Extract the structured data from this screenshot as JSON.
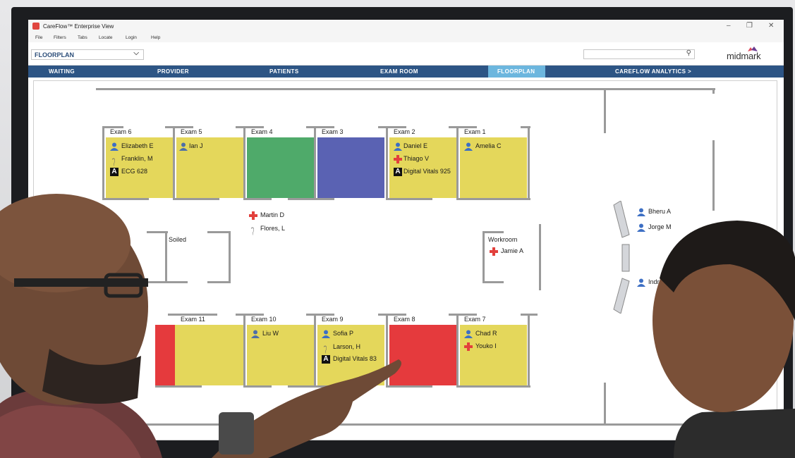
{
  "window": {
    "title": "CareFlow™ Enterprise View"
  },
  "menu": [
    "File",
    "Filters",
    "Tabs",
    "Locate",
    "Login",
    "Help"
  ],
  "view_selector": {
    "value": "FLOORPLAN"
  },
  "brand": {
    "name": "midmark"
  },
  "nav": [
    "WAITING",
    "PROVIDER",
    "PATIENTS",
    "EXAM ROOM",
    "FLOORPLAN",
    "CAREFLOW ANALYTICS >"
  ],
  "nav_active": "FLOORPLAN",
  "rooms_top": [
    {
      "label": "Exam 6",
      "color": "#e4d75b",
      "people": [
        "Elizabeth E",
        "Franklin, M",
        "ECG 628"
      ]
    },
    {
      "label": "Exam 5",
      "color": "#e4d75b",
      "people": [
        "Ian J"
      ]
    },
    {
      "label": "Exam 4",
      "color": "#4faa6a",
      "people": []
    },
    {
      "label": "Exam 3",
      "color": "#5a62b3",
      "people": []
    },
    {
      "label": "Exam 2",
      "color": "#e4d75b",
      "people": [
        "Daniel E",
        "Thiago V",
        "Digital Vitals 925"
      ]
    },
    {
      "label": "Exam 1",
      "color": "#e4d75b",
      "people": [
        "Amelia C"
      ]
    }
  ],
  "rooms_bottom": [
    {
      "label": "Exam 11",
      "color": "#e4d75b",
      "people": []
    },
    {
      "label": "Exam 10",
      "color": "#e4d75b",
      "people": [
        "Liu W"
      ]
    },
    {
      "label": "Exam 9",
      "color": "#e4d75b",
      "people": [
        "Sofia P",
        "Larson, H",
        "Digital Vitals 83"
      ]
    },
    {
      "label": "Exam 8",
      "color": "#e53a3d",
      "people": []
    },
    {
      "label": "Exam 7",
      "color": "#e4d75b",
      "people": [
        "Chad R",
        "Youko I"
      ]
    }
  ],
  "hallway": {
    "people": [
      "Martin D",
      "Flores, L"
    ]
  },
  "soiled": {
    "label": "Soiled"
  },
  "workroom": {
    "label": "Workroom",
    "people": [
      "Jamie A"
    ]
  },
  "lobby": {
    "people": [
      "Bheru A",
      "Jorge M",
      "Indra"
    ]
  }
}
